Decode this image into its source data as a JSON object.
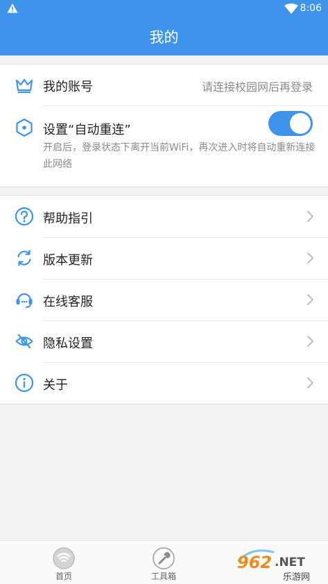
{
  "status_bar": {
    "time": "8:06",
    "icons": [
      "warning-icon",
      "wifi-icon",
      "battery-icon"
    ]
  },
  "header": {
    "title": "我的"
  },
  "account": {
    "label": "我的账号",
    "value": "请连接校园网后再登录",
    "icon": "crown-icon"
  },
  "auto_reconnect": {
    "label": "设置“自动重连”",
    "description": "开启后，登录状态下离开当前WiFi，再次进入时将自动重新连接此网络",
    "enabled": true,
    "icon": "hexagon-dot-icon"
  },
  "menu": [
    {
      "label": "帮助指引",
      "icon": "help-icon"
    },
    {
      "label": "版本更新",
      "icon": "refresh-icon"
    },
    {
      "label": "在线客服",
      "icon": "headset-icon"
    },
    {
      "label": "隐私设置",
      "icon": "eye-off-icon"
    },
    {
      "label": "关于",
      "icon": "info-icon"
    }
  ],
  "tabs": [
    {
      "label": "首页",
      "icon": "wifi-circle-icon"
    },
    {
      "label": "工具箱",
      "icon": "wrench-icon"
    }
  ],
  "watermark": {
    "text": "962.NET",
    "subtext": "乐游网"
  },
  "colors": {
    "primary": "#3e93ea",
    "background": "#f2f2f2",
    "secondary_text": "#8a8a8a"
  }
}
